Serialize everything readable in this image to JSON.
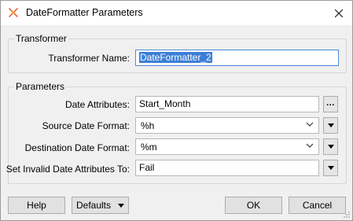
{
  "window": {
    "title": "DateFormatter Parameters"
  },
  "transformer": {
    "group_label": "Transformer",
    "name_label": "Transformer Name:",
    "name_value": "DateFormatter_2"
  },
  "parameters": {
    "group_label": "Parameters",
    "date_attributes": {
      "label": "Date Attributes:",
      "value": "Start_Month",
      "browse_label": "..."
    },
    "source_format": {
      "label": "Source Date Format:",
      "value": "%h"
    },
    "destination_format": {
      "label": "Destination Date Format:",
      "value": "%m"
    },
    "invalid_to": {
      "label": "Set Invalid Date Attributes To:",
      "value": "Fail"
    }
  },
  "buttons": {
    "help": "Help",
    "defaults": "Defaults",
    "ok": "OK",
    "cancel": "Cancel"
  },
  "colors": {
    "selection": "#3d7fd6",
    "focus_border": "#4b8bd6",
    "background": "#f0f0f0"
  }
}
